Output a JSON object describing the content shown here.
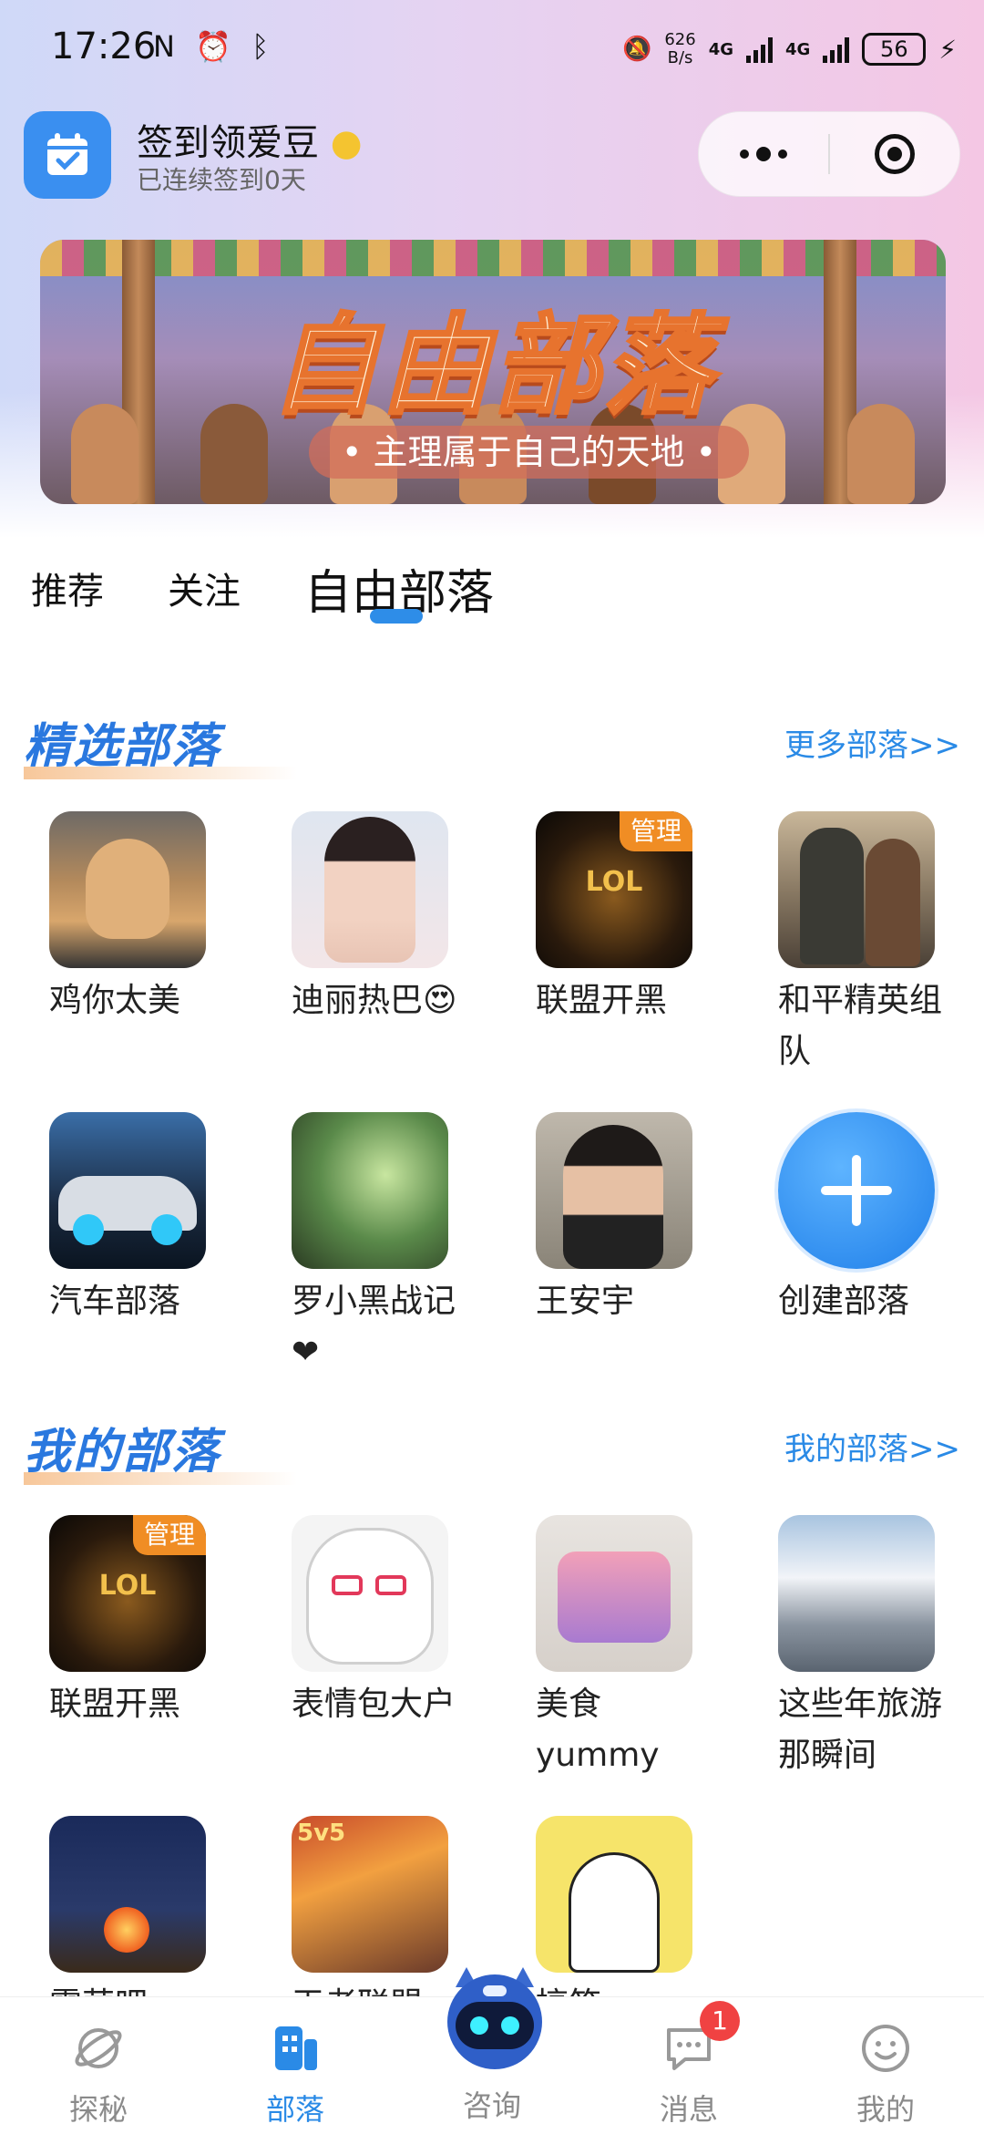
{
  "status_bar": {
    "time": "17:26",
    "net_speed_top": "626",
    "net_speed_bottom": "B/s",
    "signal1": "4G",
    "signal2": "4G",
    "battery": "56"
  },
  "mini_program": {
    "title": "签到领爱豆",
    "subtitle": "已连续签到0天"
  },
  "banner": {
    "title": "自由部落",
    "tagline": "• 主理属于自己的天地 •"
  },
  "tabs": [
    {
      "label": "推荐",
      "active": false
    },
    {
      "label": "关注",
      "active": false
    },
    {
      "label": "自由部落",
      "active": true
    }
  ],
  "featured": {
    "title": "精选部落",
    "more": "更多部落>>",
    "items": [
      {
        "label": "鸡你太美",
        "badge": ""
      },
      {
        "label": "迪丽热巴😍",
        "badge": ""
      },
      {
        "label": "联盟开黑",
        "badge": "管理"
      },
      {
        "label": "和平精英组队",
        "badge": ""
      },
      {
        "label": "汽车部落",
        "badge": ""
      },
      {
        "label": "罗小黑战记❤",
        "badge": ""
      },
      {
        "label": "王安宇",
        "badge": ""
      },
      {
        "label": "创建部落",
        "badge": ""
      }
    ]
  },
  "mine": {
    "title": "我的部落",
    "more": "我的部落>>",
    "items": [
      {
        "label": "联盟开黑",
        "badge": "管理"
      },
      {
        "label": "表情包大户",
        "badge": ""
      },
      {
        "label": "美食yummy",
        "badge": ""
      },
      {
        "label": "这些年旅游那瞬间",
        "badge": ""
      },
      {
        "label": "露营吧",
        "badge": ""
      },
      {
        "label": "王者联盟",
        "badge": ""
      },
      {
        "label": "搞笑",
        "badge": ""
      }
    ]
  },
  "bottom_nav": [
    {
      "label": "探秘",
      "icon": "planet-icon"
    },
    {
      "label": "部落",
      "icon": "tribe-icon"
    },
    {
      "label": "咨询",
      "icon": "robot-icon"
    },
    {
      "label": "消息",
      "icon": "chat-icon",
      "badge": "1"
    },
    {
      "label": "我的",
      "icon": "smiley-icon"
    }
  ],
  "colors": {
    "accent": "#2a8ae6",
    "badge_orange": "#f08d24",
    "notify_red": "#f04242"
  }
}
